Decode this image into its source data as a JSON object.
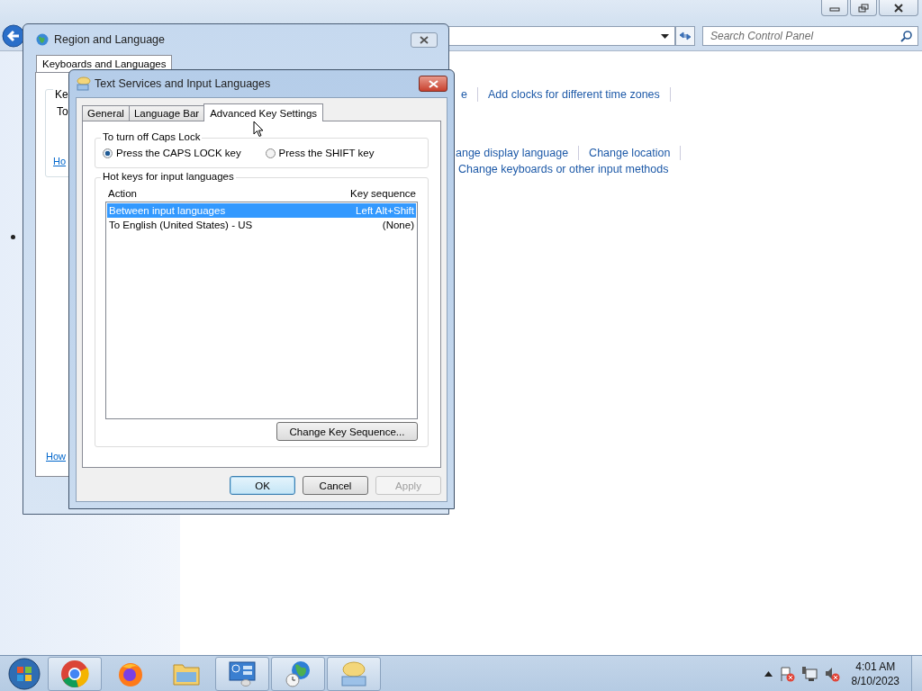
{
  "control_panel": {
    "search": {
      "placeholder": "Search Control Panel"
    },
    "link_rows": [
      {
        "items": [
          "e",
          "Add clocks for different time zones"
        ]
      },
      {
        "items": [
          "ange display language",
          "Change location"
        ]
      },
      {
        "items": [
          "Change keyboards or other input methods"
        ]
      }
    ]
  },
  "region_dialog": {
    "title": "Region and Language",
    "tabs": [
      {
        "label": "Keyboards and Languages",
        "selected": true
      }
    ],
    "group_label": "Ke",
    "text": "To",
    "links": [
      "Ho",
      "How"
    ]
  },
  "text_services_dialog": {
    "title": "Text Services and Input Languages",
    "tabs": [
      {
        "label": "General",
        "selected": false
      },
      {
        "label": "Language Bar",
        "selected": false
      },
      {
        "label": "Advanced Key Settings",
        "selected": true
      }
    ],
    "caps_lock_group": {
      "label": "To turn off Caps Lock",
      "options": [
        {
          "label": "Press the CAPS LOCK key",
          "selected": true
        },
        {
          "label": "Press the SHIFT key",
          "selected": false
        }
      ]
    },
    "hotkeys_group": {
      "label": "Hot keys for input languages",
      "columns": [
        "Action",
        "Key sequence"
      ],
      "rows": [
        {
          "action": "Between input languages",
          "key_sequence": "Left Alt+Shift",
          "selected": true
        },
        {
          "action": "To English (United States) - US",
          "key_sequence": "(None)",
          "selected": false
        }
      ],
      "change_button": "Change Key Sequence..."
    },
    "buttons": [
      {
        "label": "OK",
        "default": true,
        "disabled": false
      },
      {
        "label": "Cancel",
        "default": false,
        "disabled": false
      },
      {
        "label": "Apply",
        "default": false,
        "disabled": true
      }
    ]
  },
  "taskbar": {
    "apps": [
      {
        "kind": "chrome",
        "running": true
      },
      {
        "kind": "firefox",
        "running": false
      },
      {
        "kind": "folder",
        "running": false
      },
      {
        "kind": "control_panel",
        "running": true
      },
      {
        "kind": "globe_clock",
        "running": true
      },
      {
        "kind": "keyboard",
        "running": true
      }
    ],
    "clock": {
      "time": "4:01 AM",
      "date": "8/10/2023"
    }
  }
}
